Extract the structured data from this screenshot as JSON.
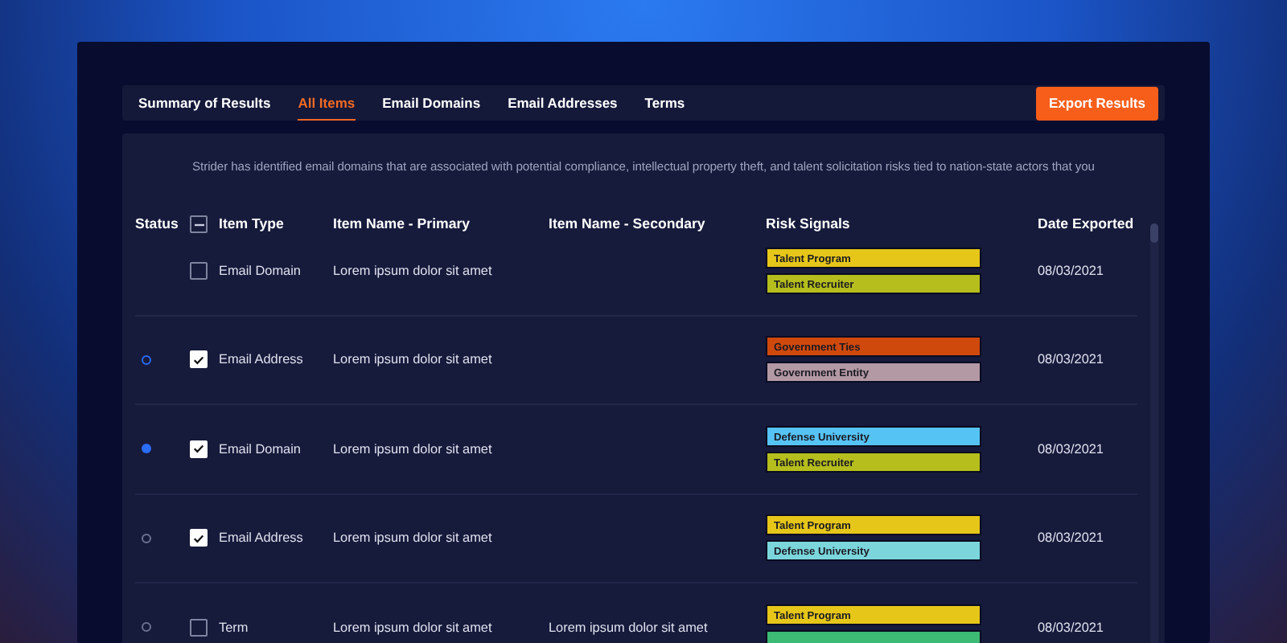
{
  "tabs": [
    {
      "label": "Summary of Results",
      "selected": false
    },
    {
      "label": "All Items",
      "selected": true
    },
    {
      "label": "Email Domains",
      "selected": false
    },
    {
      "label": "Email Addresses",
      "selected": false
    },
    {
      "label": "Terms",
      "selected": false
    }
  ],
  "export_button": "Export Results",
  "description": "Strider has identified email domains that are associated with potential compliance, intellectual property theft, and talent solicitation risks tied to nation-state actors that you",
  "table": {
    "columns": [
      "Status",
      "Item Type",
      "Item Name - Primary",
      "Item Name - Secondary",
      "Risk Signals",
      "Date Exported"
    ],
    "select_all": {
      "indeterminate": true
    },
    "rows": [
      {
        "checked": false,
        "type": "Email Domain",
        "primary": "Lorem ipsum dolor sit amet",
        "secondary": "",
        "signals": [
          {
            "label": "Talent Program",
            "color": "#e6c619"
          },
          {
            "label": "Talent Recruiter",
            "color": "#b5be1c"
          }
        ],
        "date": "08/03/2021"
      },
      {
        "dot": {
          "filled": false,
          "color": "#2a6df6"
        },
        "checked": true,
        "type": "Email Address",
        "primary": "Lorem ipsum dolor sit amet",
        "secondary": "",
        "signals": [
          {
            "label": "Government Ties",
            "color": "#d0490c"
          },
          {
            "label": "Government Entity",
            "color": "#b399a4"
          }
        ],
        "date": "08/03/2021"
      },
      {
        "dot": {
          "filled": true,
          "color": "#2a6df6"
        },
        "checked": true,
        "type": "Email Domain",
        "primary": "Lorem ipsum dolor sit amet",
        "secondary": "",
        "signals": [
          {
            "label": "Defense University",
            "color": "#56c3f5"
          },
          {
            "label": "Talent Recruiter",
            "color": "#b5be1c"
          }
        ],
        "date": "08/03/2021"
      },
      {
        "dot": {
          "filled": false,
          "color": "#6d7290"
        },
        "checked": true,
        "type": "Email Address",
        "primary": "Lorem ipsum dolor sit amet",
        "secondary": "",
        "signals": [
          {
            "label": "Talent Program",
            "color": "#e6c619"
          },
          {
            "label": "Defense University",
            "color": "#7bd6dc"
          }
        ],
        "date": "08/03/2021"
      },
      {
        "dot": {
          "filled": false,
          "color": "#6d7290"
        },
        "checked": false,
        "type": "Term",
        "primary": "Lorem ipsum dolor sit amet",
        "secondary": "Lorem ipsum dolor sit amet",
        "signals": [
          {
            "label": "Talent Program",
            "color": "#e6c619"
          },
          {
            "color": "#3dba74"
          }
        ],
        "date": "08/03/2021"
      }
    ]
  }
}
